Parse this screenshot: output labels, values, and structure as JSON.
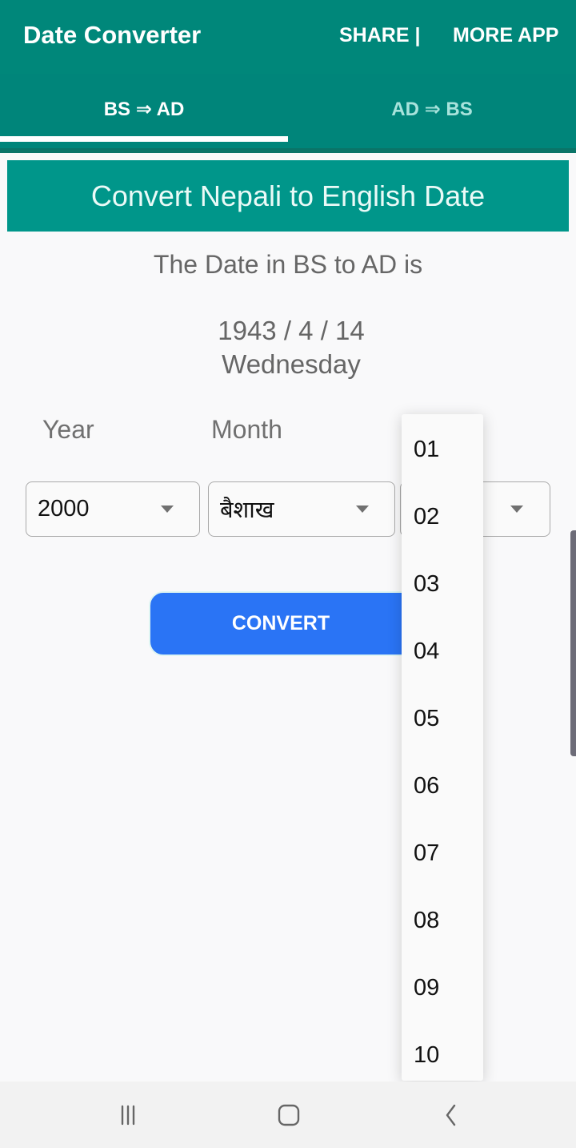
{
  "appbar": {
    "title": "Date Converter",
    "actions": {
      "share": "SHARE |",
      "more_app": "MORE APP"
    }
  },
  "tabs": [
    {
      "label": "BS ⇒ AD",
      "active": true
    },
    {
      "label": "AD ⇒ BS",
      "active": false
    }
  ],
  "banner": {
    "title": "Convert Nepali to English Date"
  },
  "result": {
    "label": "The Date in BS to AD is",
    "date": "1943 / 4 / 14",
    "weekday": "Wednesday"
  },
  "form": {
    "year_label": "Year",
    "month_label": "Month",
    "year_value": "2000",
    "month_value": "बैशाख",
    "day_value": "",
    "convert_label": "CONVERT"
  },
  "day_dropdown": {
    "options": [
      "01",
      "02",
      "03",
      "04",
      "05",
      "06",
      "07",
      "08",
      "09",
      "10"
    ]
  },
  "colors": {
    "appbar": "#00877a",
    "banner": "#00968a",
    "button": "#2a74f5",
    "inactive_tab_text": "#a8e3dc"
  },
  "navbar": {
    "icons": [
      "recent-apps-icon",
      "home-icon",
      "back-icon"
    ]
  }
}
